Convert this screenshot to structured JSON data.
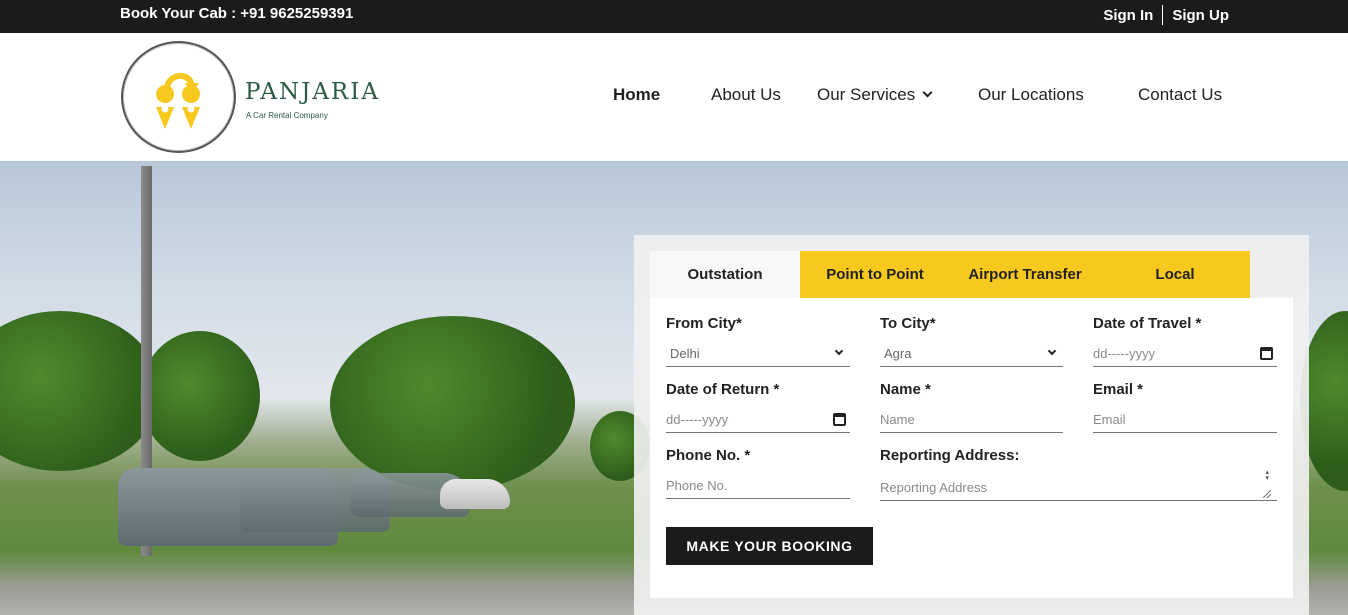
{
  "topbar": {
    "phone_text": "Book Your Cab : +91 9625259391",
    "sign_in": "Sign In",
    "sign_up": "Sign Up"
  },
  "brand": {
    "name": "PANJARIA",
    "tagline": "A Car Rental Company",
    "logo_icon": "location-pins-route-icon",
    "colors": {
      "brand_green": "#2c5b45",
      "accent_yellow": "#f7c81e"
    }
  },
  "nav": {
    "items": [
      {
        "label": "Home",
        "active": true
      },
      {
        "label": "About Us"
      },
      {
        "label": "Our Services",
        "has_dropdown": true
      },
      {
        "label": "Our Locations"
      },
      {
        "label": "Contact Us"
      }
    ]
  },
  "booking": {
    "tabs": [
      {
        "label": "Outstation",
        "active": true
      },
      {
        "label": "Point to Point"
      },
      {
        "label": "Airport Transfer"
      },
      {
        "label": "Local"
      }
    ],
    "fields": {
      "from_city": {
        "label": "From City*",
        "value": "Delhi"
      },
      "to_city": {
        "label": "To City*",
        "value": "Agra"
      },
      "date_travel": {
        "label": "Date of Travel *",
        "placeholder": "dd-----yyyy"
      },
      "date_return": {
        "label": "Date of Return *",
        "placeholder": "dd-----yyyy"
      },
      "name": {
        "label": "Name *",
        "placeholder": "Name"
      },
      "email": {
        "label": "Email *",
        "placeholder": "Email"
      },
      "phone": {
        "label": "Phone No. *",
        "placeholder": "Phone No."
      },
      "address": {
        "label": "Reporting Address:",
        "placeholder": "Reporting Address"
      }
    },
    "submit_label": "MAKE YOUR BOOKING"
  }
}
